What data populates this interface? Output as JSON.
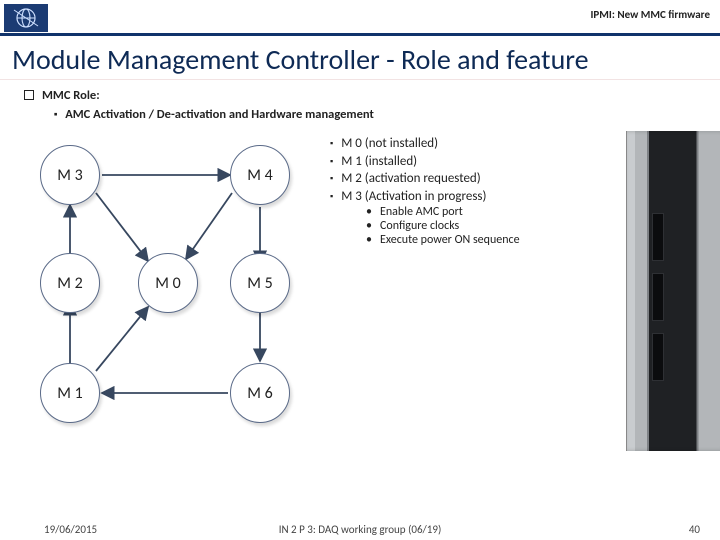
{
  "header": {
    "breadcrumb": "IPMI: New MMC firmware"
  },
  "title": "Module Management Controller - Role and feature",
  "role_label": "MMC Role:",
  "subrole_label": "AMC Activation / De-activation and Hardware management",
  "nodes": {
    "m3": "M 3",
    "m4": "M 4",
    "m2": "M 2",
    "m0": "M 0",
    "m5": "M 5",
    "m1": "M 1",
    "m6": "M 6"
  },
  "states": [
    "M 0 (not installed)",
    "M 1 (installed)",
    "M 2 (activation requested)",
    "M 3 (Activation in progress)"
  ],
  "substates": [
    "Enable AMC port",
    "Configure clocks",
    "Execute power ON sequence"
  ],
  "footer": {
    "date": "19/06/2015",
    "center": "IN 2 P 3: DAQ working group (06/19)",
    "page": "40"
  }
}
